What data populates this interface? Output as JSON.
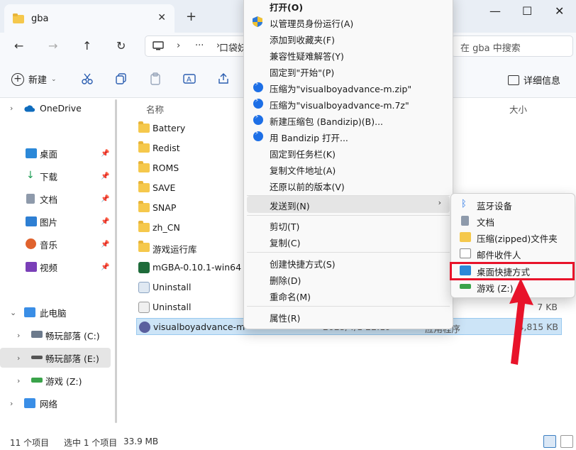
{
  "window": {
    "tab_title": "gba",
    "new_tab": "+",
    "minimize": "—",
    "maximize": "☐",
    "close": "✕"
  },
  "nav": {
    "back": "←",
    "forward": "→",
    "up": "↑",
    "refresh": "↻",
    "address_more": "···",
    "address_segment": "口袋妖",
    "search_placeholder": "在 gba 中搜索"
  },
  "toolbar": {
    "new_label": "新建",
    "details_label": "详细信息"
  },
  "sidebar": {
    "items": [
      {
        "label": "OneDrive"
      },
      {
        "label": "桌面"
      },
      {
        "label": "下载"
      },
      {
        "label": "文档"
      },
      {
        "label": "图片"
      },
      {
        "label": "音乐"
      },
      {
        "label": "视频"
      },
      {
        "label": "此电脑"
      },
      {
        "label": "畅玩部落 (C:)"
      },
      {
        "label": "畅玩部落 (E:)"
      },
      {
        "label": "游戏 (Z:)"
      },
      {
        "label": "网络"
      }
    ]
  },
  "list": {
    "col_name": "名称",
    "col_size": "大小",
    "rows": [
      {
        "name": "Battery"
      },
      {
        "name": "Redist"
      },
      {
        "name": "ROMS"
      },
      {
        "name": "SAVE"
      },
      {
        "name": "SNAP"
      },
      {
        "name": "zh_CN"
      },
      {
        "name": "游戏运行库"
      },
      {
        "name": "mGBA-0.10.1-win64"
      },
      {
        "name": "Uninstall"
      },
      {
        "name": "Uninstall",
        "type": "置",
        "size": "7 KB"
      },
      {
        "name": "visualboyadvance-m",
        "date": "2023/4/1 22:19",
        "type": "应用程序",
        "size": "4,815 KB"
      }
    ]
  },
  "status": {
    "count": "11 个项目",
    "selected": "选中 1 个项目",
    "size": "33.9 MB"
  },
  "context_menu": {
    "items": [
      "打开(O)",
      "以管理员身份运行(A)",
      "添加到收藏夹(F)",
      "兼容性疑难解答(Y)",
      "固定到\"开始\"(P)",
      "压缩为\"visualboyadvance-m.zip\"",
      "压缩为\"visualboyadvance-m.7z\"",
      "新建压缩包 (Bandizip)(B)...",
      "用 Bandizip 打开...",
      "固定到任务栏(K)",
      "复制文件地址(A)",
      "还原以前的版本(V)",
      "发送到(N)",
      "剪切(T)",
      "复制(C)",
      "创建快捷方式(S)",
      "删除(D)",
      "重命名(M)",
      "属性(R)"
    ],
    "submenu_arrow": "›"
  },
  "send_to": {
    "items": [
      "蓝牙设备",
      "文档",
      "压缩(zipped)文件夹",
      "邮件收件人",
      "桌面快捷方式",
      "游戏 (Z:)"
    ]
  },
  "colors": {
    "highlight": "#e8132a",
    "accent": "#1d6fe6",
    "selection": "#cce4f7"
  }
}
